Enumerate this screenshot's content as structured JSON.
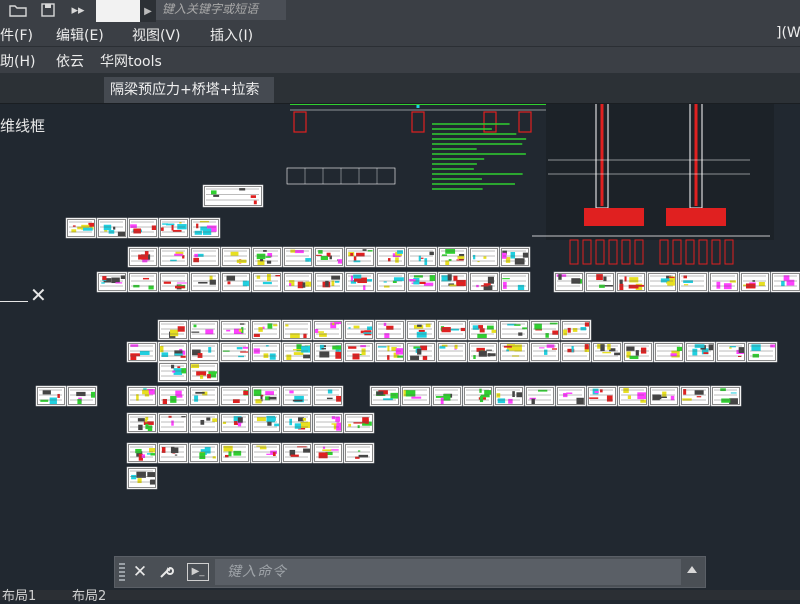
{
  "titlebar": {
    "search_placeholder": "键入关键字或短语"
  },
  "menu": {
    "row1": [
      "件(F)",
      "编辑(E)",
      "视图(V)",
      "插入(I)",
      "](W"
    ],
    "row2": [
      "助(H)",
      "依云",
      "华网tools"
    ]
  },
  "file_tab": {
    "label": "隔梁预应力+桥塔+拉索"
  },
  "viewport": {
    "visual_style": "维线框"
  },
  "commandline": {
    "placeholder": "键入命令"
  },
  "layouts": [
    "布局1",
    "布局2"
  ],
  "colors": {
    "background": "#212830",
    "ribbon": "#3b3f45",
    "drawing_red": "#e02020",
    "drawing_yellow": "#e8e020",
    "drawing_cyan": "#20d0e0",
    "drawing_green": "#30d030"
  },
  "icons": [
    "folder-open-icon",
    "save-icon",
    "double-arrow-icon",
    "close-icon",
    "wrench-icon",
    "command-prompt-icon",
    "triangle-up-icon"
  ]
}
